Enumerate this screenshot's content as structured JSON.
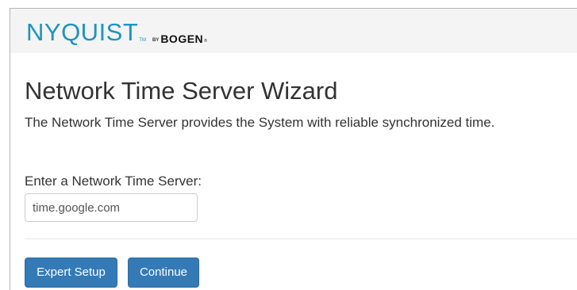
{
  "header": {
    "brand": "NYQUIST",
    "brand_tm": "TM",
    "brand_by": "BY",
    "brand_company": "BOGEN",
    "brand_company_mark": "®",
    "logo_color": "#1d94bf"
  },
  "wizard": {
    "title": "Network Time Server Wizard",
    "description": "The Network Time Server provides the System with reliable synchronized time.",
    "field_label": "Enter a Network Time Server:",
    "server_value": "time.google.com"
  },
  "actions": {
    "expert_setup_label": "Expert Setup",
    "continue_label": "Continue",
    "button_color": "#337ab7"
  }
}
